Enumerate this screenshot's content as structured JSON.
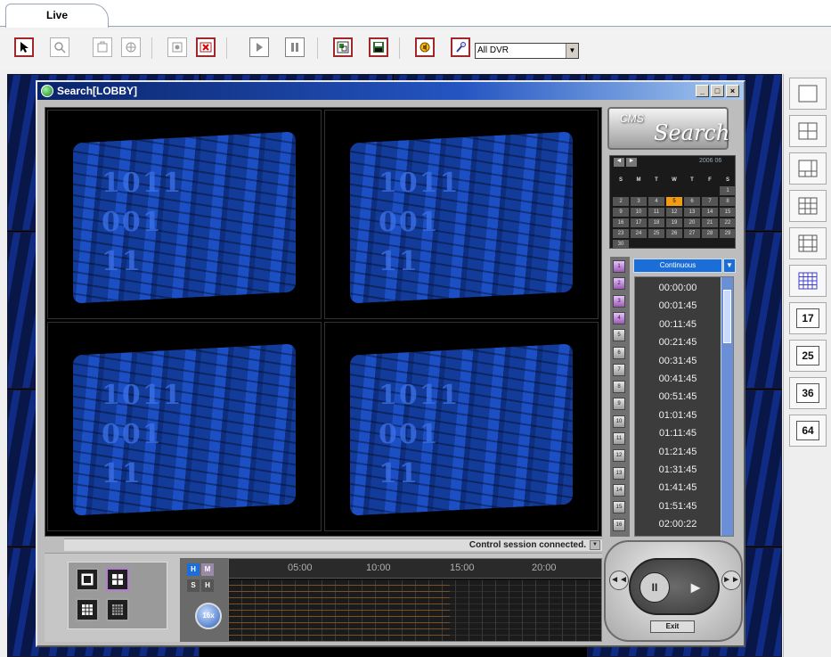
{
  "tabs": [
    {
      "label": "Live"
    }
  ],
  "toolbar": {
    "dvr_select": {
      "value": "All DVR"
    }
  },
  "search_window": {
    "title": "Search[LOBBY]",
    "controls": {
      "minimize": "_",
      "restore": "□",
      "close": "×"
    },
    "cms_logo": {
      "small": "CMS",
      "big": "Search"
    },
    "calendar": {
      "month_label": "2006 06",
      "weekday_headers": [
        "S",
        "M",
        "T",
        "W",
        "T",
        "F",
        "S"
      ],
      "days": [
        "",
        "",
        "",
        "",
        "",
        "",
        "1",
        "2",
        "3",
        "4",
        "5",
        "6",
        "7",
        "8",
        "9",
        "10",
        "11",
        "12",
        "13",
        "14",
        "15",
        "16",
        "17",
        "18",
        "19",
        "20",
        "21",
        "22",
        "23",
        "24",
        "25",
        "26",
        "27",
        "28",
        "29",
        "30"
      ],
      "selected_day": "5"
    },
    "camera_numbers": [
      "1",
      "2",
      "3",
      "4",
      "5",
      "6",
      "7",
      "8",
      "9",
      "10",
      "11",
      "12",
      "13",
      "14",
      "15",
      "16"
    ],
    "mode": "Continuous",
    "times": [
      "00:00:00",
      "00:01:45",
      "00:11:45",
      "00:21:45",
      "00:31:45",
      "00:41:45",
      "00:51:45",
      "01:01:45",
      "01:11:45",
      "01:21:45",
      "01:31:45",
      "01:41:45",
      "01:51:45",
      "02:00:22"
    ],
    "status": "Control session connected.",
    "timeline_hours": [
      "05:00",
      "10:00",
      "15:00",
      "20:00"
    ],
    "speed": {
      "h": "H",
      "m": "M",
      "s": "S",
      "x": "H",
      "knob": "16x"
    },
    "exit_label": "Exit"
  },
  "layout_panel": {
    "numbers": [
      "17",
      "25",
      "36",
      "64"
    ]
  },
  "colors": {
    "title_bar": "#0a246a",
    "accent_red": "#a0282a",
    "calendar_selected": "#f39c12",
    "mode_blue": "#1b6ed8"
  }
}
